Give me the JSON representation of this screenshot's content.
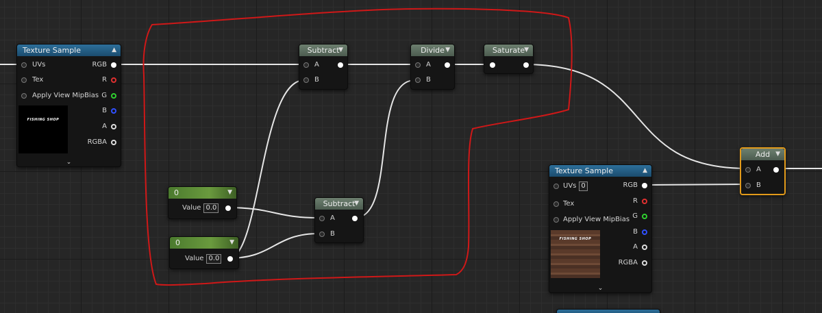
{
  "texture_sample_1": {
    "title": "Texture Sample",
    "inputs": [
      "UVs",
      "Tex",
      "Apply View MipBias"
    ],
    "outputs": [
      "RGB",
      "R",
      "G",
      "B",
      "A",
      "RGBA"
    ],
    "thumbnail_text": "FISHING SHOP"
  },
  "texture_sample_2": {
    "title": "Texture Sample",
    "inputs": [
      "UVs",
      "Tex",
      "Apply View MipBias"
    ],
    "uvs_value": "0",
    "outputs": [
      "RGB",
      "R",
      "G",
      "B",
      "A",
      "RGBA"
    ],
    "thumbnail_text": "FISHING SHOP"
  },
  "subtract_1": {
    "title": "Subtract",
    "a": "A",
    "b": "B"
  },
  "subtract_2": {
    "title": "Subtract",
    "a": "A",
    "b": "B"
  },
  "divide": {
    "title": "Divide",
    "a": "A",
    "b": "B"
  },
  "saturate": {
    "title": "Saturate"
  },
  "add": {
    "title": "Add",
    "a": "A",
    "b": "B"
  },
  "constant_1": {
    "title": "0",
    "value_label": "Value",
    "value": "0.0"
  },
  "constant_2": {
    "title": "0",
    "value_label": "Value",
    "value": "0.0"
  },
  "colors": {
    "wire": "#e6e6e6",
    "annotation": "#d01818",
    "selection": "#e29a1a",
    "pin_r": "#e03030",
    "pin_g": "#30d030",
    "pin_b": "#3050ff"
  }
}
